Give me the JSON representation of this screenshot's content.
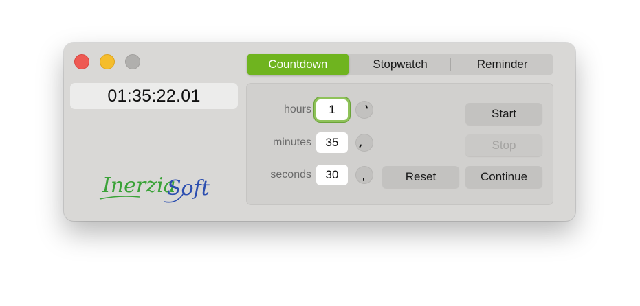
{
  "window": {
    "time_display": "01:35:22.01",
    "logo": {
      "part1": "Inerzia",
      "part2": "Soft",
      "colors": {
        "green": "#3aa238",
        "blue": "#2d4fb0"
      }
    }
  },
  "tabs": [
    {
      "label": "Countdown",
      "active": true
    },
    {
      "label": "Stopwatch",
      "active": false
    },
    {
      "label": "Reminder",
      "active": false
    }
  ],
  "countdown": {
    "hours": {
      "label": "hours",
      "value": "1"
    },
    "minutes": {
      "label": "minutes",
      "value": "35"
    },
    "seconds": {
      "label": "seconds",
      "value": "30"
    },
    "buttons": {
      "start": "Start",
      "stop": "Stop",
      "reset": "Reset",
      "continue": "Continue"
    }
  },
  "colors": {
    "accent": "#6fb41f",
    "close": "#ee5a53",
    "minimize": "#f5bd2d",
    "zoom": "#b0afad"
  }
}
